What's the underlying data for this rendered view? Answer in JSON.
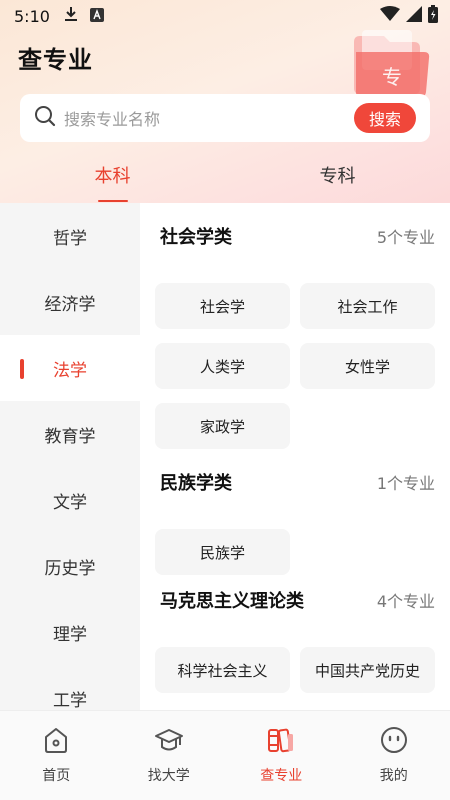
{
  "status_bar": {
    "time": "5:10"
  },
  "header": {
    "title": "查专业",
    "deco_glyph": "专"
  },
  "search": {
    "placeholder": "搜索专业名称",
    "button_label": "搜索"
  },
  "level_tabs": [
    {
      "label": "本科",
      "active": true
    },
    {
      "label": "专科",
      "active": false
    }
  ],
  "sidebar": {
    "items": [
      {
        "label": "哲学"
      },
      {
        "label": "经济学"
      },
      {
        "label": "法学",
        "active": true
      },
      {
        "label": "教育学"
      },
      {
        "label": "文学"
      },
      {
        "label": "历史学"
      },
      {
        "label": "理学"
      },
      {
        "label": "工学"
      }
    ]
  },
  "categories": [
    {
      "title": "社会学类",
      "count": "5个专业",
      "majors": [
        "社会学",
        "社会工作",
        "人类学",
        "女性学",
        "家政学"
      ]
    },
    {
      "title": "民族学类",
      "count": "1个专业",
      "majors": [
        "民族学"
      ]
    },
    {
      "title": "马克思主义理论类",
      "count": "4个专业",
      "majors": [
        "科学社会主义",
        "中国共产党历史"
      ]
    }
  ],
  "tabbar": [
    {
      "label": "首页",
      "icon": "home-icon"
    },
    {
      "label": "找大学",
      "icon": "graduation-cap-icon"
    },
    {
      "label": "查专业",
      "icon": "books-icon",
      "active": true
    },
    {
      "label": "我的",
      "icon": "smiley-icon"
    }
  ],
  "colors": {
    "accent": "#e8412f",
    "search_button": "#f0473a",
    "sidebar_bg": "#f5f5f5",
    "chip_bg": "#f5f5f5"
  }
}
